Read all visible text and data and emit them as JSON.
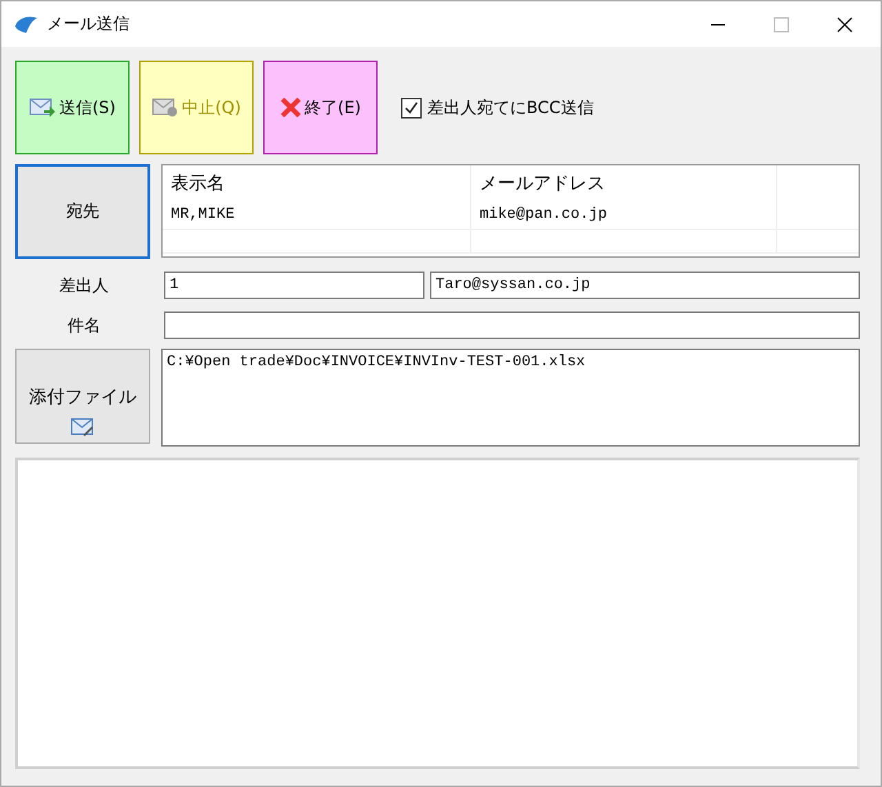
{
  "window": {
    "title": "メール送信"
  },
  "toolbar": [
    {
      "kind": "send",
      "label": "送信(S)"
    },
    {
      "kind": "stop",
      "label": "中止(Q)"
    },
    {
      "kind": "exit",
      "label": "終了(E)"
    }
  ],
  "bcc_checkbox": {
    "label": "差出人宛てにBCC送信",
    "checked": true
  },
  "recipients": {
    "button": "宛先",
    "columns": [
      "表示名",
      "メールアドレス"
    ],
    "rows": [
      [
        "MR,MIKE",
        "mike@pan.co.jp"
      ]
    ]
  },
  "sender": {
    "label": "差出人",
    "id": "1",
    "address": "Taro@syssan.co.jp"
  },
  "subject": {
    "label": "件名"
  },
  "attachments": {
    "button": "添付ファイル",
    "files": [
      "C:¥Open trade¥Doc¥INVOICE¥INVInv-TEST-001.xlsx"
    ]
  }
}
